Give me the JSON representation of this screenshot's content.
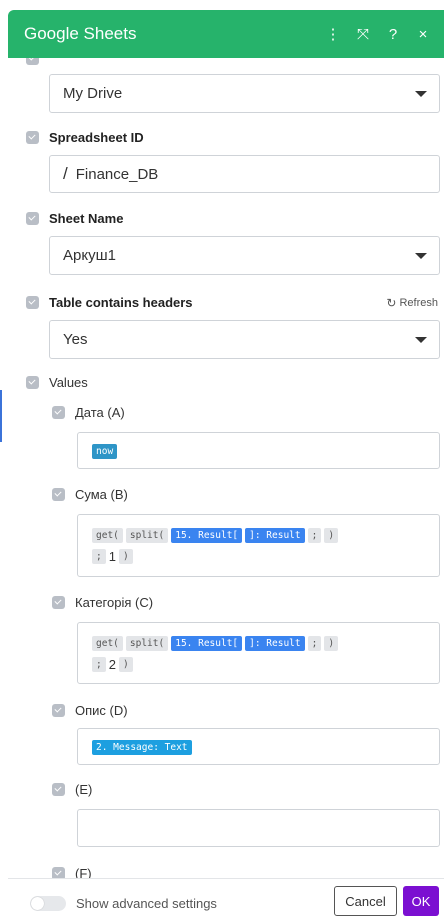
{
  "header": {
    "title": "Google Sheets",
    "actions": [
      {
        "icon": "more-vertical-icon",
        "glyph": "⋮"
      },
      {
        "icon": "expand-icon",
        "glyph": "⤧"
      },
      {
        "icon": "help-icon",
        "glyph": "?"
      },
      {
        "icon": "close-icon",
        "glyph": "×"
      }
    ],
    "color": "#26b36b"
  },
  "fields": {
    "drive": {
      "value": "My Drive"
    },
    "spreadsheet_id": {
      "label": "Spreadsheet ID",
      "value": "Finance_DB"
    },
    "sheet_name": {
      "label": "Sheet Name",
      "value": "Аркуш1"
    },
    "headers": {
      "label": "Table contains headers",
      "value": "Yes",
      "refresh": "Refresh"
    },
    "values": {
      "label": "Values"
    }
  },
  "columns": {
    "a": {
      "label": "Дата (A)",
      "pill": "now"
    },
    "b": {
      "label": "Сума (B)",
      "line1": [
        "get(",
        "split(",
        "15. Result[",
        "]: Result",
        ";",
        ")"
      ],
      "line2_sep": ";",
      "line2_num": "1",
      "line2_close": ")"
    },
    "c": {
      "label": "Категорія (C)",
      "line1": [
        "get(",
        "split(",
        "15. Result[",
        "]: Result",
        ";",
        ")"
      ],
      "line2_sep": ";",
      "line2_num": "2",
      "line2_close": ")"
    },
    "d": {
      "label": "Опис (D)",
      "pill": "2. Message: Text"
    },
    "e": {
      "label": "(E)"
    },
    "f": {
      "label": "(F)"
    }
  },
  "footer": {
    "advanced_label": "Show advanced settings",
    "advanced_enabled": false,
    "cancel": "Cancel",
    "ok": "OK",
    "ok_color": "#7b0fd1"
  }
}
